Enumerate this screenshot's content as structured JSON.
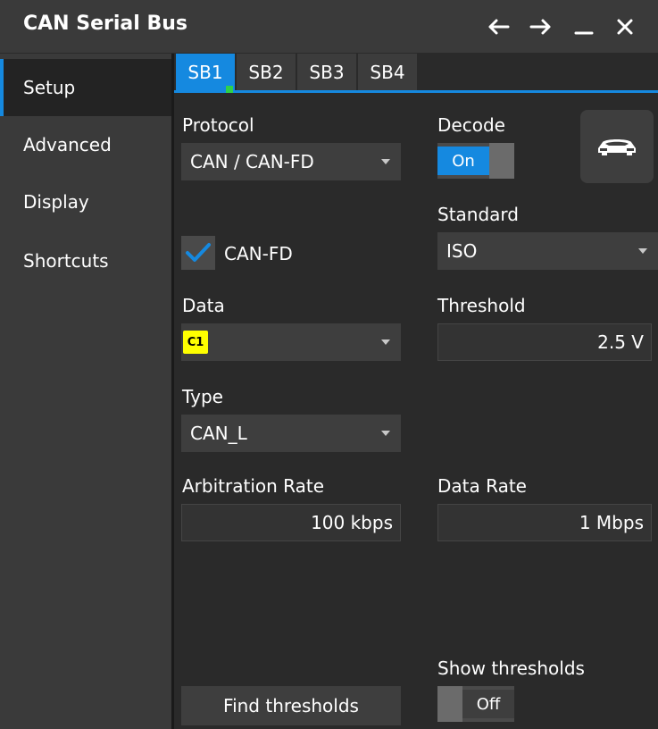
{
  "window": {
    "title": "CAN Serial Bus",
    "controls": [
      "back-arrow-icon",
      "forward-arrow-icon",
      "minimize-icon",
      "close-icon"
    ]
  },
  "sidebar": {
    "items": [
      {
        "label": "Setup",
        "active": true
      },
      {
        "label": "Advanced",
        "active": false
      },
      {
        "label": "Display",
        "active": false
      },
      {
        "label": "Shortcuts",
        "active": false
      }
    ]
  },
  "tabs": [
    {
      "label": "SB1",
      "active": true
    },
    {
      "label": "SB2",
      "active": false
    },
    {
      "label": "SB3",
      "active": false
    },
    {
      "label": "SB4",
      "active": false
    }
  ],
  "protocol": {
    "label": "Protocol",
    "value": "CAN / CAN-FD"
  },
  "decode": {
    "label": "Decode",
    "state": "On"
  },
  "car_icon": "car-icon",
  "can_fd": {
    "label": "CAN-FD",
    "checked": true
  },
  "standard": {
    "label": "Standard",
    "value": "ISO"
  },
  "data": {
    "label": "Data",
    "channel": "C1"
  },
  "threshold": {
    "label": "Threshold",
    "value": "2.5 V"
  },
  "type": {
    "label": "Type",
    "value": "CAN_L"
  },
  "arbitration_rate": {
    "label": "Arbitration Rate",
    "value": "100 kbps"
  },
  "data_rate": {
    "label": "Data Rate",
    "value": "1 Mbps"
  },
  "show_thresholds": {
    "label": "Show thresholds",
    "state": "Off"
  },
  "find_thresholds": {
    "label": "Find thresholds"
  },
  "colors": {
    "accent": "#1589e0",
    "channel_c1": "#ffff00",
    "active_indicator": "#2ed14a",
    "panel": "#2a2a2a",
    "sidebar": "#3a3a3a"
  }
}
